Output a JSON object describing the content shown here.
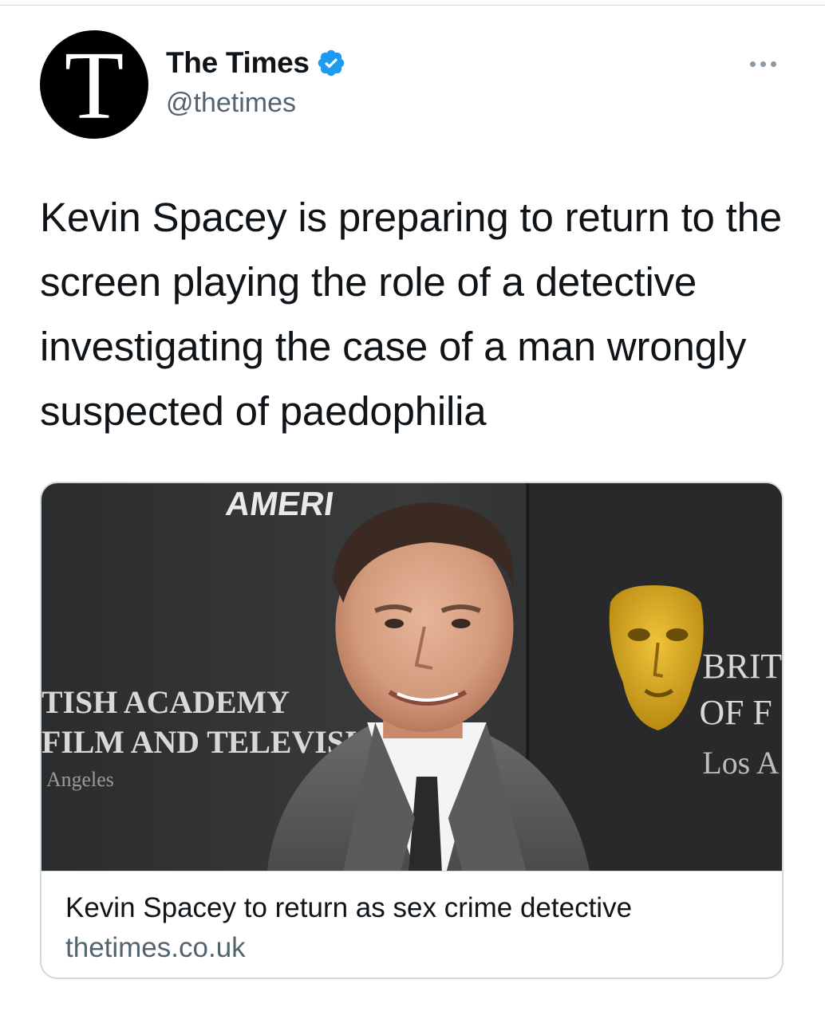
{
  "tweet": {
    "author": {
      "display_name": "The Times",
      "handle": "@thetimes",
      "avatar_letter": "T",
      "verified": true,
      "verified_icon": "verified-badge-icon",
      "verified_color": "#1d9bf0"
    },
    "more_icon": "ellipsis-icon",
    "text": "Kevin Spacey is preparing to return to the screen playing the role of a detective investigating the case of a man wrongly suspected of paedophilia",
    "card": {
      "image_description_icon": "news-photo",
      "backdrop_text": {
        "top": "AMERI",
        "left_line1": "TISH ACADEMY",
        "left_line2": "FILM AND TELEVISION A",
        "left_line3": "Angeles",
        "right_line1": "BRIT",
        "right_line2": "OF F",
        "right_line3": "Los A"
      },
      "title": "Kevin Spacey to return as sex crime detective",
      "domain": "thetimes.co.uk"
    }
  },
  "colors": {
    "text_primary": "#0f1419",
    "text_secondary": "#536471",
    "border": "#cfd9de",
    "accent": "#1d9bf0"
  }
}
